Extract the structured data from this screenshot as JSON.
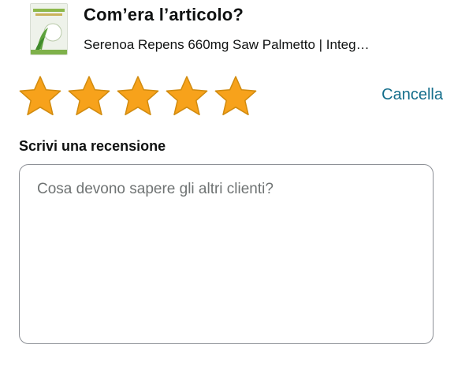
{
  "header": {
    "title": "Com’era l’articolo?",
    "product_name": "Serenoa Repens 660mg Saw Palmetto | Integ…"
  },
  "rating": {
    "value": 5,
    "max": 5,
    "star_color": "#f7a21b",
    "star_outline": "#d18b0f",
    "cancel_label": "Cancella"
  },
  "review": {
    "label": "Scrivi una recensione",
    "placeholder": "Cosa devono sapere gli altri clienti?",
    "value": ""
  },
  "colors": {
    "link": "#146e8b",
    "text": "#0f1111",
    "placeholder": "#6f7373",
    "border": "#8d9096"
  }
}
